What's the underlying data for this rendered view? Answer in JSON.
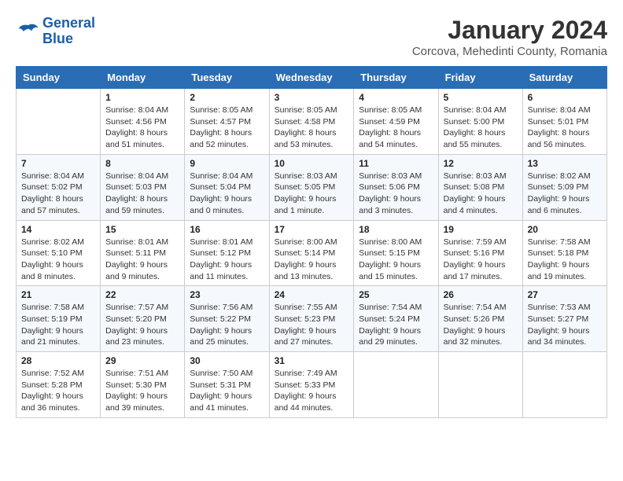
{
  "header": {
    "logo_line1": "General",
    "logo_line2": "Blue",
    "month_title": "January 2024",
    "subtitle": "Corcova, Mehedinti County, Romania"
  },
  "weekdays": [
    "Sunday",
    "Monday",
    "Tuesday",
    "Wednesday",
    "Thursday",
    "Friday",
    "Saturday"
  ],
  "weeks": [
    [
      {
        "day": "",
        "info": ""
      },
      {
        "day": "1",
        "info": "Sunrise: 8:04 AM\nSunset: 4:56 PM\nDaylight: 8 hours\nand 51 minutes."
      },
      {
        "day": "2",
        "info": "Sunrise: 8:05 AM\nSunset: 4:57 PM\nDaylight: 8 hours\nand 52 minutes."
      },
      {
        "day": "3",
        "info": "Sunrise: 8:05 AM\nSunset: 4:58 PM\nDaylight: 8 hours\nand 53 minutes."
      },
      {
        "day": "4",
        "info": "Sunrise: 8:05 AM\nSunset: 4:59 PM\nDaylight: 8 hours\nand 54 minutes."
      },
      {
        "day": "5",
        "info": "Sunrise: 8:04 AM\nSunset: 5:00 PM\nDaylight: 8 hours\nand 55 minutes."
      },
      {
        "day": "6",
        "info": "Sunrise: 8:04 AM\nSunset: 5:01 PM\nDaylight: 8 hours\nand 56 minutes."
      }
    ],
    [
      {
        "day": "7",
        "info": "Sunrise: 8:04 AM\nSunset: 5:02 PM\nDaylight: 8 hours\nand 57 minutes."
      },
      {
        "day": "8",
        "info": "Sunrise: 8:04 AM\nSunset: 5:03 PM\nDaylight: 8 hours\nand 59 minutes."
      },
      {
        "day": "9",
        "info": "Sunrise: 8:04 AM\nSunset: 5:04 PM\nDaylight: 9 hours\nand 0 minutes."
      },
      {
        "day": "10",
        "info": "Sunrise: 8:03 AM\nSunset: 5:05 PM\nDaylight: 9 hours\nand 1 minute."
      },
      {
        "day": "11",
        "info": "Sunrise: 8:03 AM\nSunset: 5:06 PM\nDaylight: 9 hours\nand 3 minutes."
      },
      {
        "day": "12",
        "info": "Sunrise: 8:03 AM\nSunset: 5:08 PM\nDaylight: 9 hours\nand 4 minutes."
      },
      {
        "day": "13",
        "info": "Sunrise: 8:02 AM\nSunset: 5:09 PM\nDaylight: 9 hours\nand 6 minutes."
      }
    ],
    [
      {
        "day": "14",
        "info": "Sunrise: 8:02 AM\nSunset: 5:10 PM\nDaylight: 9 hours\nand 8 minutes."
      },
      {
        "day": "15",
        "info": "Sunrise: 8:01 AM\nSunset: 5:11 PM\nDaylight: 9 hours\nand 9 minutes."
      },
      {
        "day": "16",
        "info": "Sunrise: 8:01 AM\nSunset: 5:12 PM\nDaylight: 9 hours\nand 11 minutes."
      },
      {
        "day": "17",
        "info": "Sunrise: 8:00 AM\nSunset: 5:14 PM\nDaylight: 9 hours\nand 13 minutes."
      },
      {
        "day": "18",
        "info": "Sunrise: 8:00 AM\nSunset: 5:15 PM\nDaylight: 9 hours\nand 15 minutes."
      },
      {
        "day": "19",
        "info": "Sunrise: 7:59 AM\nSunset: 5:16 PM\nDaylight: 9 hours\nand 17 minutes."
      },
      {
        "day": "20",
        "info": "Sunrise: 7:58 AM\nSunset: 5:18 PM\nDaylight: 9 hours\nand 19 minutes."
      }
    ],
    [
      {
        "day": "21",
        "info": "Sunrise: 7:58 AM\nSunset: 5:19 PM\nDaylight: 9 hours\nand 21 minutes."
      },
      {
        "day": "22",
        "info": "Sunrise: 7:57 AM\nSunset: 5:20 PM\nDaylight: 9 hours\nand 23 minutes."
      },
      {
        "day": "23",
        "info": "Sunrise: 7:56 AM\nSunset: 5:22 PM\nDaylight: 9 hours\nand 25 minutes."
      },
      {
        "day": "24",
        "info": "Sunrise: 7:55 AM\nSunset: 5:23 PM\nDaylight: 9 hours\nand 27 minutes."
      },
      {
        "day": "25",
        "info": "Sunrise: 7:54 AM\nSunset: 5:24 PM\nDaylight: 9 hours\nand 29 minutes."
      },
      {
        "day": "26",
        "info": "Sunrise: 7:54 AM\nSunset: 5:26 PM\nDaylight: 9 hours\nand 32 minutes."
      },
      {
        "day": "27",
        "info": "Sunrise: 7:53 AM\nSunset: 5:27 PM\nDaylight: 9 hours\nand 34 minutes."
      }
    ],
    [
      {
        "day": "28",
        "info": "Sunrise: 7:52 AM\nSunset: 5:28 PM\nDaylight: 9 hours\nand 36 minutes."
      },
      {
        "day": "29",
        "info": "Sunrise: 7:51 AM\nSunset: 5:30 PM\nDaylight: 9 hours\nand 39 minutes."
      },
      {
        "day": "30",
        "info": "Sunrise: 7:50 AM\nSunset: 5:31 PM\nDaylight: 9 hours\nand 41 minutes."
      },
      {
        "day": "31",
        "info": "Sunrise: 7:49 AM\nSunset: 5:33 PM\nDaylight: 9 hours\nand 44 minutes."
      },
      {
        "day": "",
        "info": ""
      },
      {
        "day": "",
        "info": ""
      },
      {
        "day": "",
        "info": ""
      }
    ]
  ]
}
